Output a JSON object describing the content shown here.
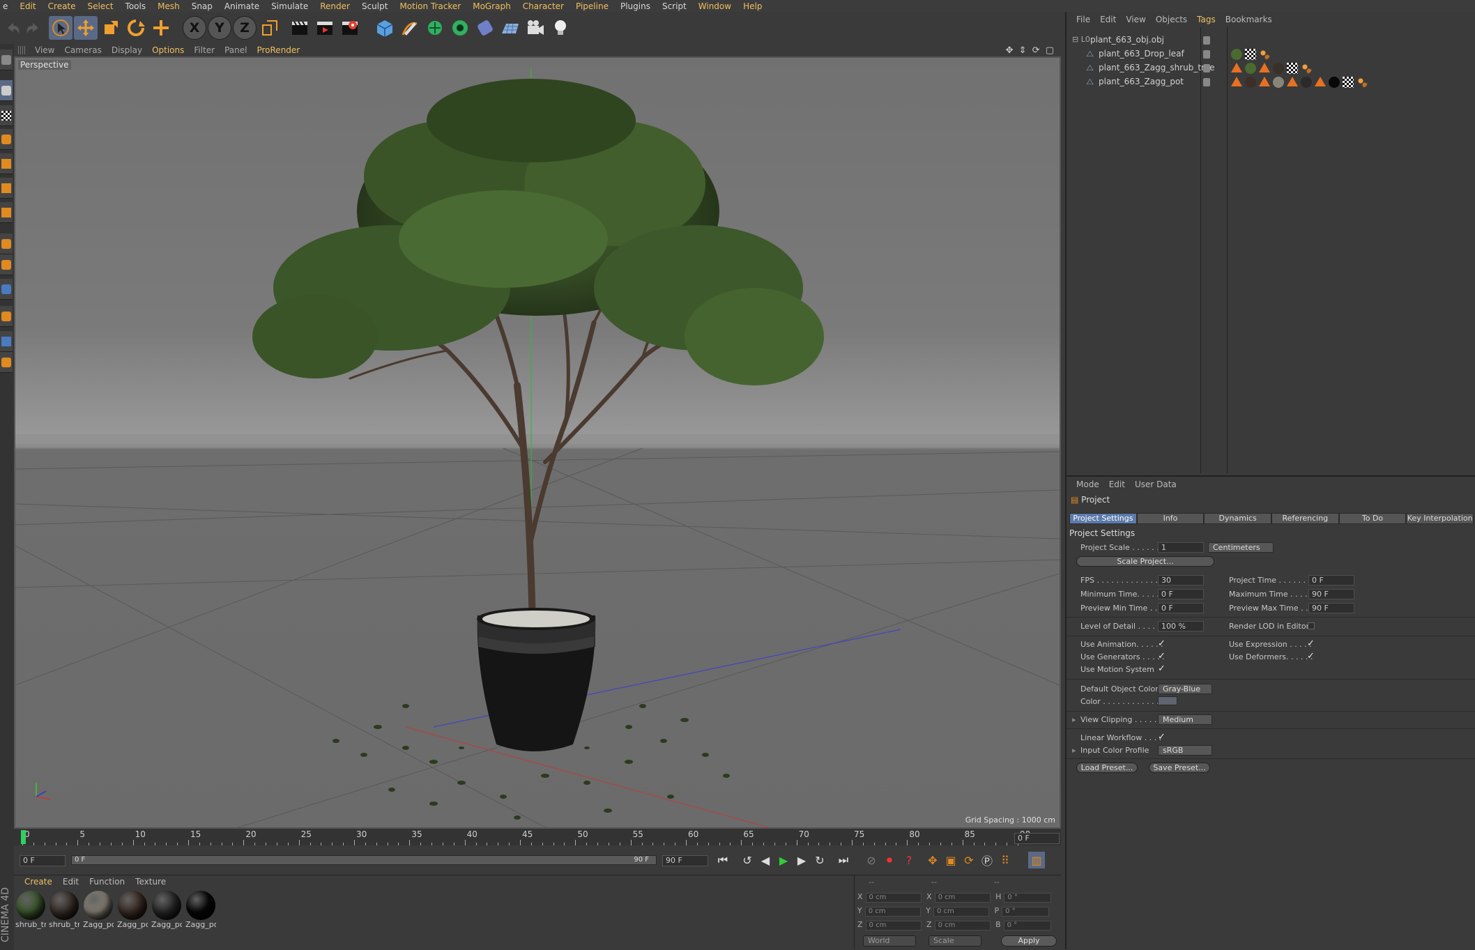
{
  "menubar": {
    "items": [
      "e",
      "Edit",
      "Create",
      "Select",
      "Tools",
      "Mesh",
      "Snap",
      "Animate",
      "Simulate",
      "Render",
      "Sculpt",
      "Motion Tracker",
      "MoGraph",
      "Character",
      "Pipeline",
      "Plugins",
      "Script",
      "Window",
      "Help"
    ]
  },
  "viewport": {
    "menu": [
      "View",
      "Cameras",
      "Display",
      "Options",
      "Filter",
      "Panel",
      "ProRender"
    ],
    "active_menu": "Options",
    "camera_label": "Perspective",
    "grid_spacing": "Grid Spacing : 1000 cm"
  },
  "timeline": {
    "ticks": [
      0,
      5,
      10,
      15,
      20,
      25,
      30,
      35,
      40,
      45,
      50,
      55,
      60,
      65,
      70,
      75,
      80,
      85,
      90
    ],
    "current_frame_right": "0 F",
    "start_field": "0 F",
    "range_start": "0 F",
    "range_end": "90 F",
    "end_field": "90 F"
  },
  "material_manager": {
    "menu": [
      "Create",
      "Edit",
      "Function",
      "Texture"
    ],
    "materials": [
      {
        "name": "shrub_tr",
        "color": "#3e5a2e"
      },
      {
        "name": "shrub_tr",
        "color": "#3a302a"
      },
      {
        "name": "Zagg_po",
        "color": "#8a8478"
      },
      {
        "name": "Zagg_po",
        "color": "#3e2e28"
      },
      {
        "name": "Zagg_po",
        "color": "#2a2a2a"
      },
      {
        "name": "Zagg_po",
        "color": "#080808"
      }
    ]
  },
  "coordinates": {
    "header_a": "--",
    "header_b": "--",
    "header_c": "--",
    "rows": [
      {
        "a": "X",
        "av": "0 cm",
        "b": "X",
        "bv": "0 cm",
        "c": "H",
        "cv": "0 °"
      },
      {
        "a": "Y",
        "av": "0 cm",
        "b": "Y",
        "bv": "0 cm",
        "c": "P",
        "cv": "0 °"
      },
      {
        "a": "Z",
        "av": "0 cm",
        "b": "Z",
        "bv": "0 cm",
        "c": "B",
        "cv": "0 °"
      }
    ],
    "mode_world": "World",
    "mode_scale": "Scale",
    "apply": "Apply"
  },
  "object_manager": {
    "menu": [
      "File",
      "Edit",
      "View",
      "Objects",
      "Tags",
      "Bookmarks"
    ],
    "active_menu": "Tags",
    "objects": [
      {
        "name": "plant_663_obj.obj"
      },
      {
        "name": "plant_663_Drop_leaf"
      },
      {
        "name": "plant_663_Zagg_shrub_tree"
      },
      {
        "name": "plant_663_Zagg_pot"
      }
    ]
  },
  "attribute_manager": {
    "menu": [
      "Mode",
      "Edit",
      "User Data"
    ],
    "title": "Project",
    "tabs": [
      "Project Settings",
      "Info",
      "Dynamics",
      "Referencing",
      "To Do",
      "Key Interpolation"
    ],
    "section": "Project Settings",
    "project_scale_label": "Project Scale . . . . . .",
    "project_scale_value": "1",
    "project_scale_unit": "Centimeters",
    "scale_project_btn": "Scale Project...",
    "fps_label": "FPS . . . . . . . . . . . . . . .",
    "fps_value": "30",
    "project_time_label": "Project Time . . . . . . . .",
    "project_time_value": "0 F",
    "min_time_label": "Minimum Time. . . . . .",
    "min_time_value": "0 F",
    "max_time_label": "Maximum Time . . . . . .",
    "max_time_value": "90 F",
    "prev_min_label": "Preview Min Time . . .",
    "prev_min_value": "0 F",
    "prev_max_label": "Preview Max Time . . .",
    "prev_max_value": "90 F",
    "lod_label": "Level of Detail . . . . .",
    "lod_value": "100 %",
    "render_lod_label": "Render LOD in Editor",
    "use_anim_label": "Use Animation. . . . . .",
    "use_expr_label": "Use Expression . . . . .",
    "use_gen_label": "Use Generators . . . . .",
    "use_def_label": "Use Deformers. . . . . .",
    "use_motion_label": "Use Motion System",
    "def_color_label": "Default Object Color",
    "def_color_value": "Gray-Blue",
    "color_label": "Color . . . . . . . . . . . .",
    "view_clip_label": "View Clipping . . . . . .",
    "view_clip_value": "Medium",
    "linear_wf_label": "Linear Workflow . . . .",
    "input_profile_label": "Input Color Profile",
    "input_profile_value": "sRGB",
    "load_preset": "Load Preset...",
    "save_preset": "Save Preset..."
  },
  "brand": "CINEMA 4D",
  "colors": {
    "accent": "#f0c060",
    "tab_active": "#5c7aaa",
    "axis_y": "#30c030",
    "axis_x": "#c03030",
    "axis_z": "#3030c0"
  }
}
